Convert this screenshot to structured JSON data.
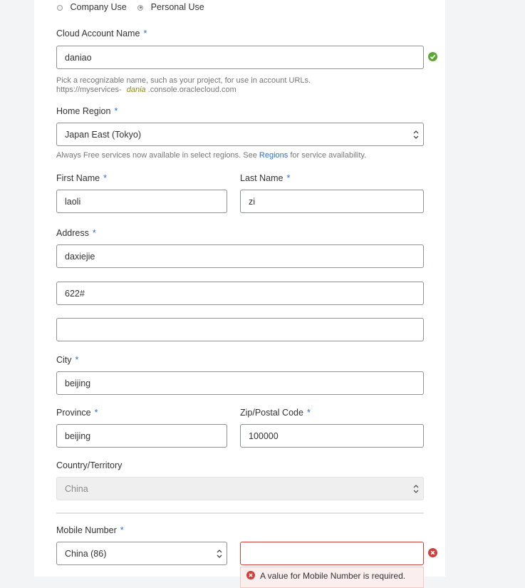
{
  "account_type": {
    "options": [
      {
        "label": "Company Use",
        "checked": false
      },
      {
        "label": "Personal Use",
        "checked": true
      }
    ]
  },
  "cloud_account": {
    "label": "Cloud Account Name",
    "required_mark": "*",
    "value": "daniao",
    "hint_line1": "Pick a recognizable name, such as your project, for use in account URLs.",
    "hint_url_prefix": "https://myservices-",
    "hint_url_name": "dania",
    "hint_url_suffix": ".console.oraclecloud.com"
  },
  "home_region": {
    "label": "Home Region",
    "required_mark": "*",
    "value": "Japan East (Tokyo)",
    "hint_prefix": "Always Free services now available in select regions. See",
    "hint_link": "Regions",
    "hint_suffix": "for service availability."
  },
  "first_name": {
    "label": "First Name",
    "required_mark": "*",
    "value": "laoli"
  },
  "last_name": {
    "label": "Last Name",
    "required_mark": "*",
    "value": "zi"
  },
  "address": {
    "label": "Address",
    "required_mark": "*",
    "line1": "daxiejie",
    "line2": "622#",
    "line3": ""
  },
  "city": {
    "label": "City",
    "required_mark": "*",
    "value": "beijing"
  },
  "province": {
    "label": "Province",
    "required_mark": "*",
    "value": "beijing"
  },
  "zip": {
    "label": "Zip/Postal Code",
    "required_mark": "*",
    "value": "100000"
  },
  "country": {
    "label": "Country/Territory",
    "value": "China"
  },
  "mobile": {
    "label": "Mobile Number",
    "required_mark": "*",
    "country_code": "China (86)",
    "value": "",
    "error": "A value for Mobile Number is required."
  },
  "colors": {
    "accent": "#2a6fdb",
    "valid": "#5aa832",
    "error": "#d53c3c"
  }
}
